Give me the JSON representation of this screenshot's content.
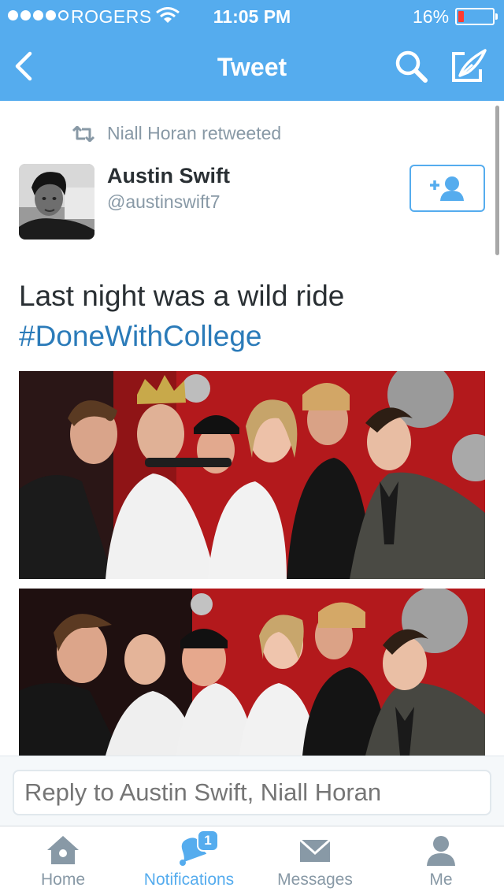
{
  "status_bar": {
    "carrier": "ROGERS",
    "time": "11:05 PM",
    "battery_percent": "16%",
    "battery_level": 0.16,
    "signal_bars": 4,
    "signal_max": 5
  },
  "nav": {
    "title": "Tweet",
    "back_icon": "chevron-left-icon",
    "search_icon": "search-icon",
    "compose_icon": "compose-icon"
  },
  "tweet": {
    "retweeted_by": "Niall Horan retweeted",
    "author_name": "Austin Swift",
    "author_handle": "@austinswift7",
    "text": "Last night was a wild ride",
    "hashtag": "#DoneWithCollege",
    "follow_icon": "add-user-icon",
    "media": [
      {
        "label": "photo-booth-image-1"
      },
      {
        "label": "photo-booth-image-2"
      }
    ]
  },
  "reply": {
    "placeholder": "Reply to Austin Swift, Niall Horan"
  },
  "tabbar": {
    "tabs": [
      {
        "label": "Home",
        "icon": "home-icon",
        "active": false
      },
      {
        "label": "Notifications",
        "icon": "bell-icon",
        "active": true,
        "badge": "1"
      },
      {
        "label": "Messages",
        "icon": "envelope-icon",
        "active": false
      },
      {
        "label": "Me",
        "icon": "person-icon",
        "active": false
      }
    ]
  },
  "colors": {
    "brand": "#55acee",
    "link": "#2b7bb9",
    "muted": "#8899a6",
    "text": "#292f33",
    "battery_low": "#ff3b30"
  }
}
